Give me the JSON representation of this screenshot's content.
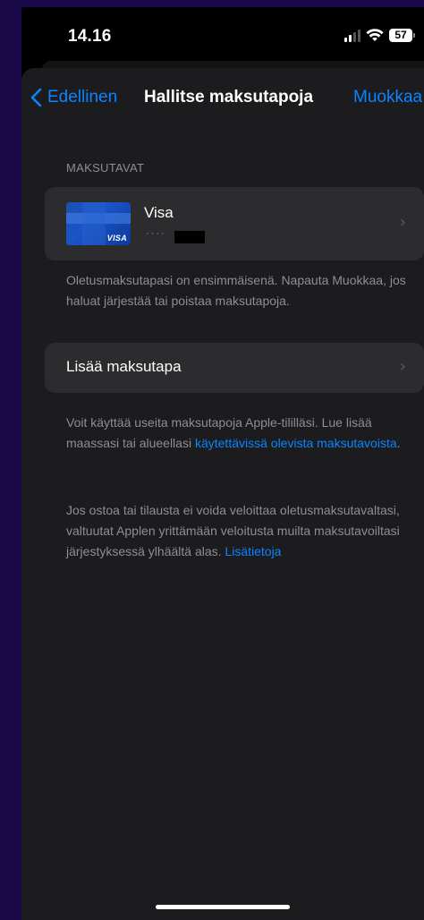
{
  "status_bar": {
    "time": "14.16",
    "battery": "57"
  },
  "nav": {
    "back_label": "Edellinen",
    "title": "Hallitse maksutapoja",
    "edit_label": "Muokkaa"
  },
  "payment_section": {
    "header": "MAKSUTAVAT",
    "card": {
      "name": "Visa",
      "brand_mark": "VISA",
      "masked_number": "····"
    },
    "footer": "Oletusmaksutapasi on ensimmäisenä. Napauta Muokkaa, jos haluat järjestää tai poistaa maksutapoja."
  },
  "add_section": {
    "label": "Lisää maksutapa"
  },
  "info": {
    "paragraph1_text": "Voit käyttää useita maksutapoja Apple-tililläsi. Lue lisää maassasi tai alueellasi ",
    "paragraph1_link": "käytettävissä olevista maksutavoista",
    "paragraph1_end": ".",
    "paragraph2_text": "Jos ostoa tai tilausta ei voida veloittaa oletusmaksutavaltasi, valtuutat Applen yrittämään veloitusta muilta maksutavoiltasi järjestyksessä ylhäältä alas. ",
    "paragraph2_link": "Lisätietoja"
  },
  "colors": {
    "accent": "#0a84ff",
    "background": "#1c1c1e",
    "cell": "#2c2c2e",
    "secondary_text": "#8e8e93"
  },
  "icons": {
    "back": "chevron-left-icon",
    "row_disclosure": "chevron-right-icon",
    "signal": "cellular-signal-icon",
    "wifi": "wifi-icon",
    "battery": "battery-icon"
  }
}
